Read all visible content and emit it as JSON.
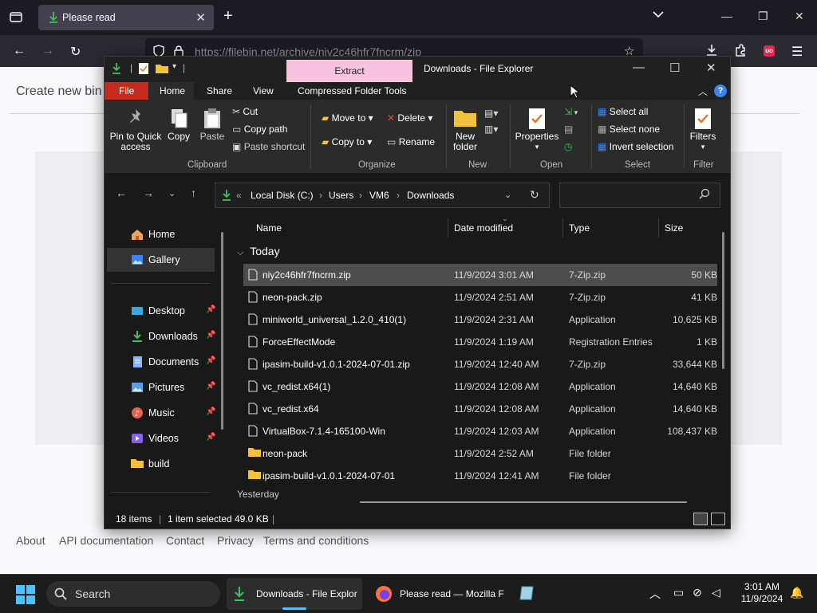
{
  "browser": {
    "tab_title": "Please read",
    "url": "https://filebin.net/archive/niy2c46hfr7fncrm/zip",
    "extension_badge": "uo"
  },
  "page": {
    "heading": "Create new bin",
    "footer_links": [
      "About",
      "API documentation",
      "Contact",
      "Privacy",
      "Terms and conditions"
    ]
  },
  "explorer": {
    "title": "Downloads - File Explorer",
    "contextual_tab": "Extract",
    "menus": {
      "file": "File",
      "home": "Home",
      "share": "Share",
      "view": "View",
      "tools": "Compressed Folder Tools"
    },
    "ribbon": {
      "pin": "Pin to Quick access",
      "pin_l1": "Pin to Quick",
      "pin_l2": "access",
      "copy": "Copy",
      "paste": "Paste",
      "cut": "Cut",
      "copy_path": "Copy path",
      "paste_shortcut": "Paste shortcut",
      "move_to": "Move to",
      "copy_to": "Copy to",
      "delete": "Delete",
      "rename": "Rename",
      "new_folder_l1": "New",
      "new_folder_l2": "folder",
      "properties": "Properties",
      "select_all": "Select all",
      "select_none": "Select none",
      "invert_selection": "Invert selection",
      "filters": "Filters",
      "groups": {
        "clipboard": "Clipboard",
        "organize": "Organize",
        "new": "New",
        "open": "Open",
        "select": "Select",
        "filter": "Filter"
      }
    },
    "breadcrumb": [
      "Local Disk (C:)",
      "Users",
      "VM6",
      "Downloads"
    ],
    "sidebar": {
      "home": "Home",
      "gallery": "Gallery",
      "pinned": [
        {
          "label": "Desktop",
          "icon": "desktop-icon"
        },
        {
          "label": "Downloads",
          "icon": "downloads-icon"
        },
        {
          "label": "Documents",
          "icon": "documents-icon"
        },
        {
          "label": "Pictures",
          "icon": "pictures-icon"
        },
        {
          "label": "Music",
          "icon": "music-icon"
        },
        {
          "label": "Videos",
          "icon": "videos-icon"
        }
      ],
      "build": "build"
    },
    "columns": {
      "name": "Name",
      "date": "Date modified",
      "type": "Type",
      "size": "Size"
    },
    "group_today": "Today",
    "group_yesterday": "Yesterday",
    "files": [
      {
        "name": "niy2c46hfr7fncrm.zip",
        "date": "11/9/2024 3:01 AM",
        "type": "7-Zip.zip",
        "size": "50 KB",
        "kind": "file",
        "selected": true
      },
      {
        "name": "neon-pack.zip",
        "date": "11/9/2024 2:51 AM",
        "type": "7-Zip.zip",
        "size": "41 KB",
        "kind": "file"
      },
      {
        "name": "miniworld_universal_1.2.0_410(1)",
        "date": "11/9/2024 2:31 AM",
        "type": "Application",
        "size": "10,625 KB",
        "kind": "file"
      },
      {
        "name": "ForceEffectMode",
        "date": "11/9/2024 1:19 AM",
        "type": "Registration Entries",
        "size": "1 KB",
        "kind": "file"
      },
      {
        "name": "ipasim-build-v1.0.1-2024-07-01.zip",
        "date": "11/9/2024 12:40 AM",
        "type": "7-Zip.zip",
        "size": "33,644 KB",
        "kind": "file"
      },
      {
        "name": "vc_redist.x64(1)",
        "date": "11/9/2024 12:08 AM",
        "type": "Application",
        "size": "14,640 KB",
        "kind": "file"
      },
      {
        "name": "vc_redist.x64",
        "date": "11/9/2024 12:08 AM",
        "type": "Application",
        "size": "14,640 KB",
        "kind": "file"
      },
      {
        "name": "VirtualBox-7.1.4-165100-Win",
        "date": "11/9/2024 12:03 AM",
        "type": "Application",
        "size": "108,437 KB",
        "kind": "file"
      },
      {
        "name": "neon-pack",
        "date": "11/9/2024 2:52 AM",
        "type": "File folder",
        "size": "",
        "kind": "folder"
      },
      {
        "name": "ipasim-build-v1.0.1-2024-07-01",
        "date": "11/9/2024 12:41 AM",
        "type": "File folder",
        "size": "",
        "kind": "folder"
      }
    ],
    "status": {
      "items": "18 items",
      "selected": "1 item selected",
      "size": "49.0 KB"
    }
  },
  "taskbar": {
    "search": "Search",
    "apps": [
      {
        "label": "Downloads - File Explor"
      },
      {
        "label": "Please read — Mozilla F"
      }
    ],
    "time": "3:01 AM",
    "date": "11/9/2024"
  }
}
